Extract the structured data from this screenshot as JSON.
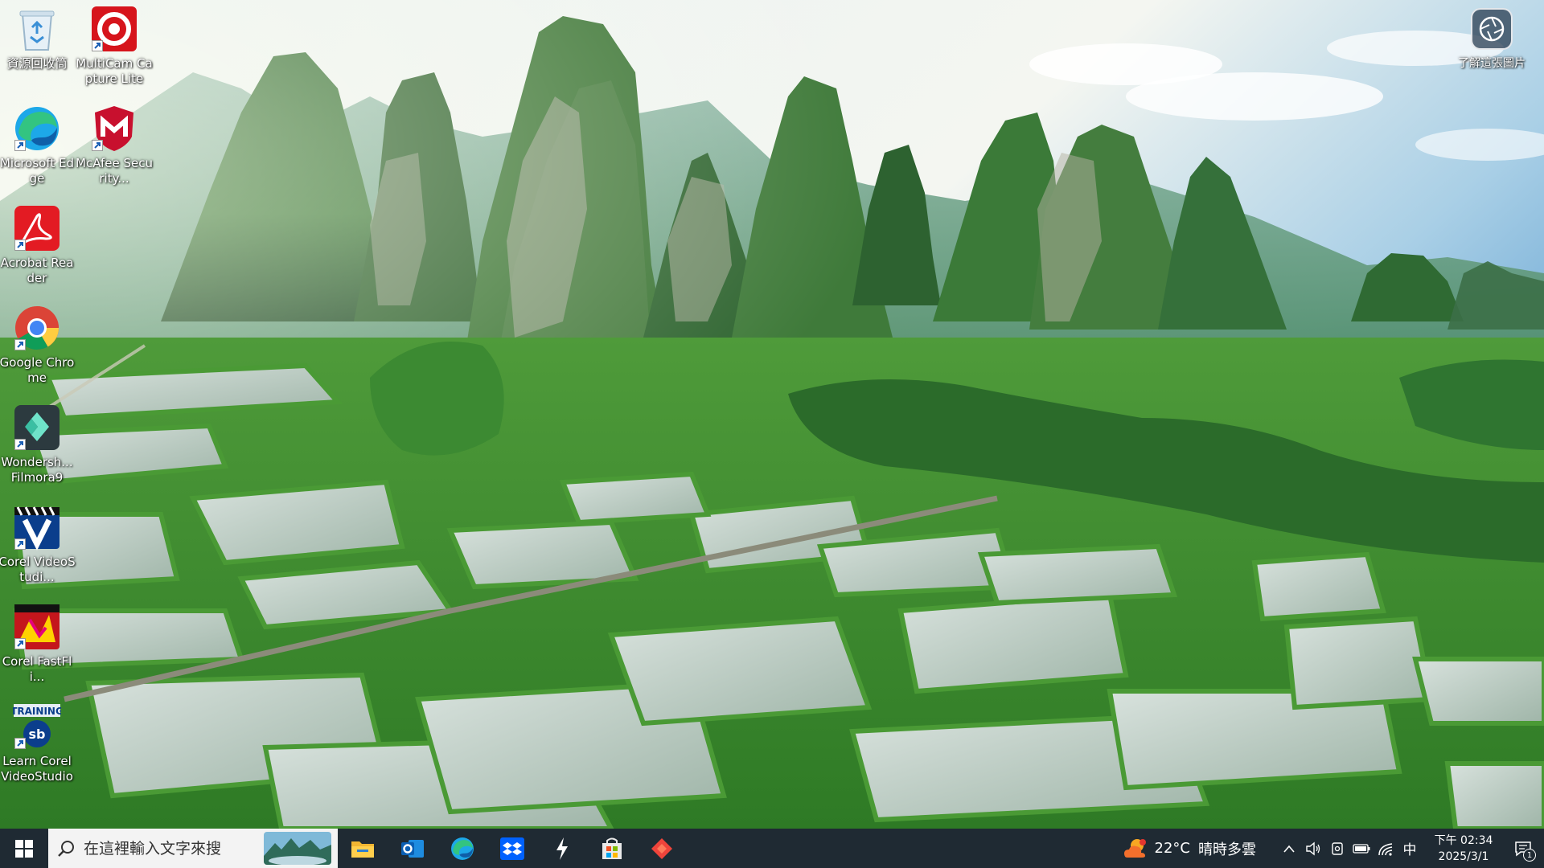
{
  "desktop": {
    "icons": [
      {
        "label": "資源回收筒",
        "icon": "recycle-bin-icon"
      },
      {
        "label": "MultiCam Capture Lite",
        "icon": "multicam-icon"
      },
      {
        "label": "Microsoft Edge",
        "icon": "edge-icon"
      },
      {
        "label": "McAfee Security...",
        "icon": "mcafee-icon"
      },
      {
        "label": "Acrobat Reader",
        "icon": "acrobat-icon"
      },
      {
        "label": "Google Chrome",
        "icon": "chrome-icon"
      },
      {
        "label": "Wondersh... Filmora9",
        "icon": "filmora-icon"
      },
      {
        "label": "Corel VideoStudi...",
        "icon": "videostudio-icon"
      },
      {
        "label": "Corel FastFli...",
        "icon": "fastflick-icon"
      },
      {
        "label": "Learn Corel VideoStudio",
        "icon": "learn-videostudio-icon"
      }
    ],
    "learn_picture": {
      "label": "了解這張圖片",
      "icon": "camera-aperture-icon"
    }
  },
  "taskbar": {
    "search_placeholder": "在這裡輸入文字來搜",
    "apps": [
      {
        "name": "file-explorer",
        "icon": "folder-icon"
      },
      {
        "name": "outlook",
        "icon": "outlook-icon"
      },
      {
        "name": "edge",
        "icon": "edge-icon"
      },
      {
        "name": "dropbox",
        "icon": "dropbox-icon"
      },
      {
        "name": "winamp",
        "icon": "bolt-icon"
      },
      {
        "name": "microsoft-store",
        "icon": "store-icon"
      },
      {
        "name": "anydesk",
        "icon": "diamond-icon"
      }
    ],
    "weather": {
      "temp": "22°C",
      "desc": "晴時多雲"
    },
    "ime": "中",
    "clock": {
      "time": "下午 02:34",
      "date": "2025/3/1"
    },
    "notifications": "1"
  },
  "colors": {
    "taskbar": "#1f2a33",
    "search_bg": "#f3f3f3",
    "accent": "#0078d4"
  }
}
